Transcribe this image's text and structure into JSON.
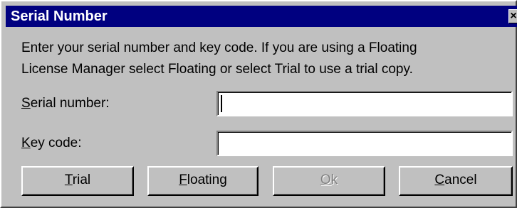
{
  "window": {
    "title": "Serial Number",
    "close_glyph": "×"
  },
  "instructions": {
    "line1": "Enter your serial number and key code. If you are using a Floating",
    "line2": "License Manager select Floating or select Trial to use a trial copy."
  },
  "fields": {
    "serial": {
      "label_mnemonic": "S",
      "label_rest": "erial number:",
      "value": ""
    },
    "key": {
      "label_mnemonic": "K",
      "label_rest": "ey code:",
      "value": ""
    }
  },
  "buttons": {
    "trial": {
      "mnemonic": "T",
      "rest": "rial",
      "enabled": true
    },
    "floating": {
      "mnemonic": "F",
      "rest": "loating",
      "enabled": true
    },
    "ok": {
      "mnemonic": "O",
      "rest": "k",
      "enabled": false
    },
    "cancel": {
      "mnemonic": "C",
      "rest": "ancel",
      "enabled": true
    }
  },
  "colors": {
    "titlebar": "#000080",
    "face": "#c0c0c0",
    "disabled_text": "#808080"
  }
}
